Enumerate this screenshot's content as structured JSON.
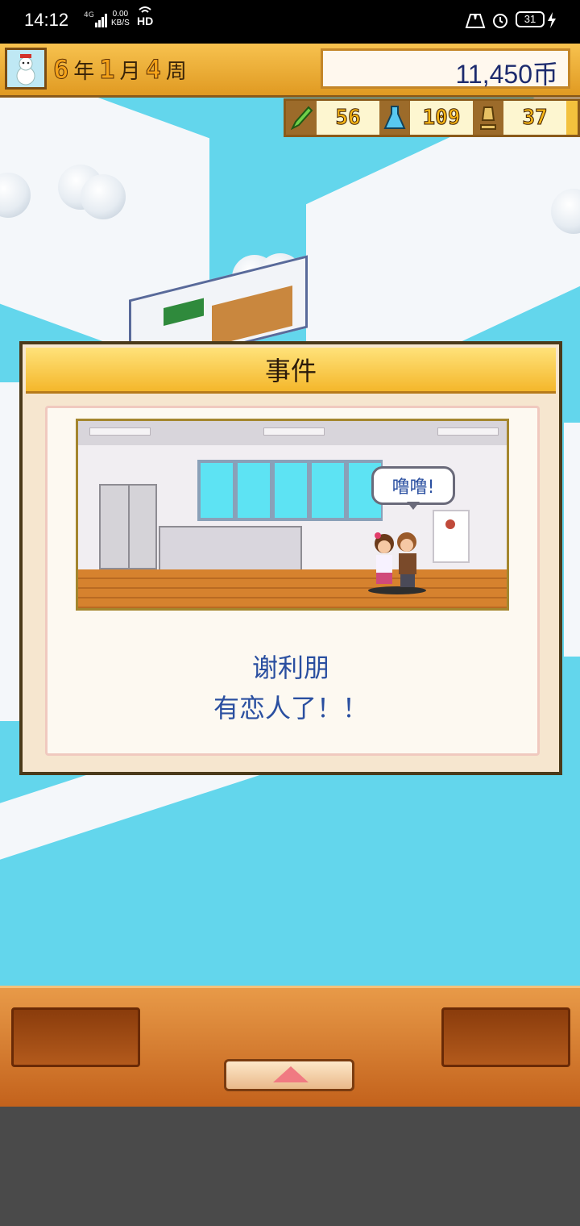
{
  "status_bar": {
    "time": "14:12",
    "network": "4G",
    "speed_value": "0.00",
    "speed_unit": "KB/S",
    "hd": "HD",
    "battery": "31"
  },
  "hud": {
    "avatar_icon": "snowman-icon",
    "year": "6",
    "year_unit": "年",
    "month": "1",
    "month_unit": "月",
    "week": "4",
    "week_unit": "周",
    "money": "11,450币"
  },
  "resources": [
    {
      "icon": "pencil-icon",
      "value": "56"
    },
    {
      "icon": "flask-icon",
      "value": "109"
    },
    {
      "icon": "trophy-icon",
      "value": "37"
    }
  ],
  "dialog": {
    "title": "事件",
    "speech_bubble": "噜噜!",
    "message_line1": "谢利朋",
    "message_line2": "有恋人了！！"
  },
  "bottom": {
    "up_button_icon": "up-arrow-icon"
  },
  "colors": {
    "water": "#63d6ec",
    "hud_orange": "#f3b12f",
    "message_blue": "#2a4fa0",
    "panel_orange": "#d97a2c"
  }
}
